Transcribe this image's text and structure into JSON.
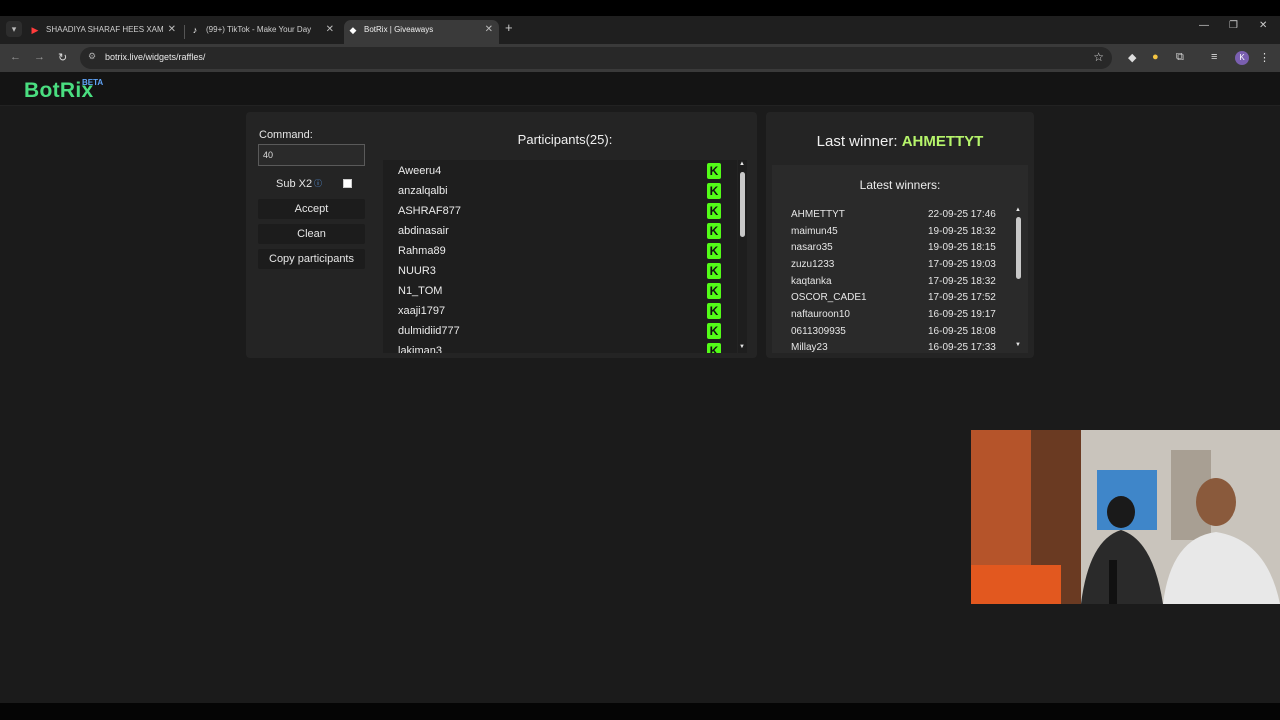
{
  "browser": {
    "tabs": [
      {
        "title": "SHAADIYA SHARAF HEES XAM",
        "favicon": "youtube-icon",
        "active": false
      },
      {
        "title": "(99+) TikTok - Make Your Day",
        "favicon": "tiktok-icon",
        "active": false
      },
      {
        "title": "BotRix | Giveaways",
        "favicon": "botrix-icon",
        "active": true
      }
    ],
    "url": "botrix.live/widgets/raffles/",
    "profile_initial": "K"
  },
  "site": {
    "logo": "BotRix",
    "beta": "BETA"
  },
  "controls": {
    "command_label": "Command:",
    "command_value": "40",
    "sub_x2_label": "Sub X2",
    "sub_x2_checked": false,
    "accept_label": "Accept",
    "clean_label": "Clean",
    "copy_label": "Copy participants"
  },
  "participants": {
    "title": "Participants(25):",
    "items": [
      "Aweeru4",
      "anzalqalbi",
      "ASHRAF877",
      "abdinasair",
      "Rahma89",
      "NUUR3",
      "N1_TOM",
      "xaaji1797",
      "dulmidiid777",
      "lakiman3"
    ],
    "platform_icon": "kick-icon",
    "platform_color": "#53fc18"
  },
  "winners": {
    "last_winner_label": "Last winner:",
    "last_winner_name": "AHMETTYT",
    "latest_title": "Latest winners:",
    "items": [
      {
        "name": "AHMETTYT",
        "date": "22-09-25 17:46"
      },
      {
        "name": "maimun45",
        "date": "19-09-25 18:32"
      },
      {
        "name": "nasaro35",
        "date": "19-09-25 18:15"
      },
      {
        "name": "zuzu1233",
        "date": "17-09-25 19:03"
      },
      {
        "name": "kaqtanka",
        "date": "17-09-25 18:32"
      },
      {
        "name": "OSCOR_CADE1",
        "date": "17-09-25 17:52"
      },
      {
        "name": "naftauroon10",
        "date": "16-09-25 19:17"
      },
      {
        "name": "0611309935",
        "date": "16-09-25 18:08"
      },
      {
        "name": "Millay23",
        "date": "16-09-25 17:33"
      }
    ]
  },
  "colors": {
    "accent": "#4ade80",
    "winner_highlight": "#b6f56b",
    "background": "#1b1b1b",
    "panel": "#242424"
  }
}
